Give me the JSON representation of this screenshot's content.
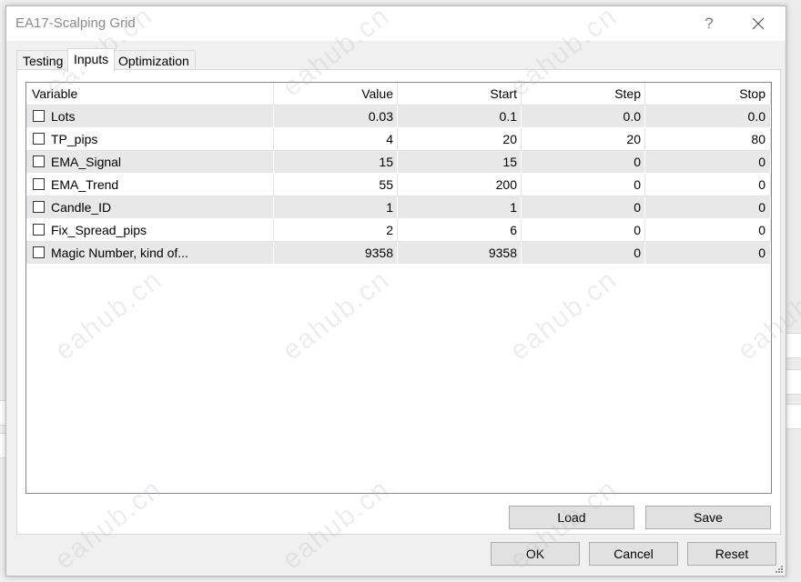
{
  "dialog": {
    "title": "EA17-Scalping Grid",
    "help_label": "?"
  },
  "tabs": [
    {
      "label": "Testing",
      "active": false
    },
    {
      "label": "Inputs",
      "active": true
    },
    {
      "label": "Optimization",
      "active": false
    }
  ],
  "grid": {
    "columns": [
      "Variable",
      "Value",
      "Start",
      "Step",
      "Stop"
    ],
    "rows": [
      {
        "checked": false,
        "variable": "Lots",
        "value": "0.03",
        "start": "0.1",
        "step": "0.0",
        "stop": "0.0"
      },
      {
        "checked": false,
        "variable": "TP_pips",
        "value": "4",
        "start": "20",
        "step": "20",
        "stop": "80"
      },
      {
        "checked": false,
        "variable": "EMA_Signal",
        "value": "15",
        "start": "15",
        "step": "0",
        "stop": "0"
      },
      {
        "checked": false,
        "variable": "EMA_Trend",
        "value": "55",
        "start": "200",
        "step": "0",
        "stop": "0"
      },
      {
        "checked": false,
        "variable": "Candle_ID",
        "value": "1",
        "start": "1",
        "step": "0",
        "stop": "0"
      },
      {
        "checked": false,
        "variable": "Fix_Spread_pips",
        "value": "2",
        "start": "6",
        "step": "0",
        "stop": "0"
      },
      {
        "checked": false,
        "variable": "Magic Number, kind of...",
        "value": "9358",
        "start": "9358",
        "step": "0",
        "stop": "0"
      }
    ]
  },
  "buttons": {
    "load": "Load",
    "save": "Save",
    "ok": "OK",
    "cancel": "Cancel",
    "reset": "Reset"
  },
  "watermark": "eahub.cn",
  "colors": {
    "shaded_row": "#e8e8e8",
    "button_bg": "#e1e1e1",
    "title_text": "#8a8a8a"
  }
}
